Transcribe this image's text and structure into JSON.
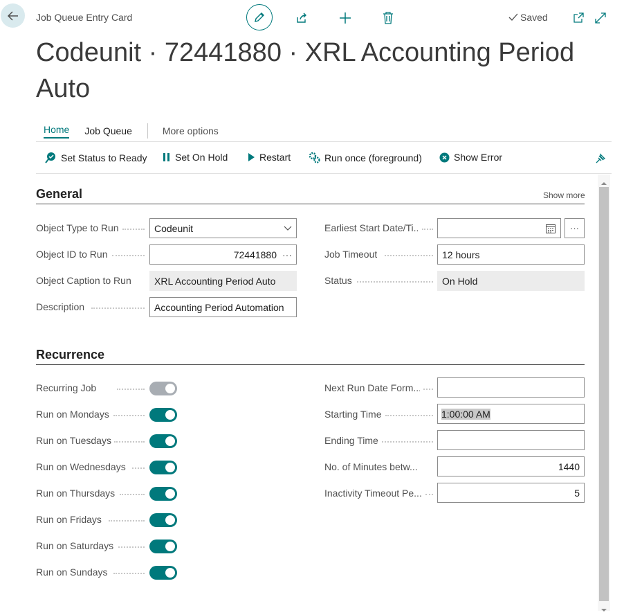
{
  "header": {
    "breadcrumb": "Job Queue Entry Card",
    "saved_label": "Saved",
    "title": "Codeunit · 72441880 · XRL Accounting Period Auto"
  },
  "tabs": {
    "home": "Home",
    "job_queue": "Job Queue",
    "more_options": "More options"
  },
  "actions": {
    "set_status_ready": "Set Status to Ready",
    "set_on_hold": "Set On Hold",
    "restart": "Restart",
    "run_once": "Run once (foreground)",
    "show_error": "Show Error"
  },
  "general": {
    "title": "General",
    "show_more": "Show more",
    "object_type_label": "Object Type to Run",
    "object_type_value": "Codeunit",
    "object_id_label": "Object ID to Run",
    "object_id_value": "72441880",
    "object_caption_label": "Object Caption to Run",
    "object_caption_value": "XRL Accounting Period Auto",
    "description_label": "Description",
    "description_value": "Accounting Period Automation",
    "earliest_start_label": "Earliest Start Date/Ti...",
    "earliest_start_value": "",
    "job_timeout_label": "Job Timeout",
    "job_timeout_value": "12 hours",
    "status_label": "Status",
    "status_value": "On Hold"
  },
  "recurrence": {
    "title": "Recurrence",
    "toggles": [
      {
        "label": "Recurring Job",
        "on": false
      },
      {
        "label": "Run on Mondays",
        "on": true
      },
      {
        "label": "Run on Tuesdays",
        "on": true
      },
      {
        "label": "Run on Wednesdays",
        "on": true
      },
      {
        "label": "Run on Thursdays",
        "on": true
      },
      {
        "label": "Run on Fridays",
        "on": true
      },
      {
        "label": "Run on Saturdays",
        "on": true
      },
      {
        "label": "Run on Sundays",
        "on": true
      }
    ],
    "next_run_label": "Next Run Date Form...",
    "next_run_value": "",
    "starting_time_label": "Starting Time",
    "starting_time_value": "1:00:00 AM",
    "ending_time_label": "Ending Time",
    "ending_time_value": "",
    "minutes_between_label": "No. of Minutes betw...",
    "minutes_between_value": "1440",
    "inactivity_label": "Inactivity Timeout Pe...",
    "inactivity_value": "5"
  },
  "colors": {
    "accent": "#00797c",
    "toggle_off": "#a8adb3",
    "readonly_bg": "#ececec"
  }
}
